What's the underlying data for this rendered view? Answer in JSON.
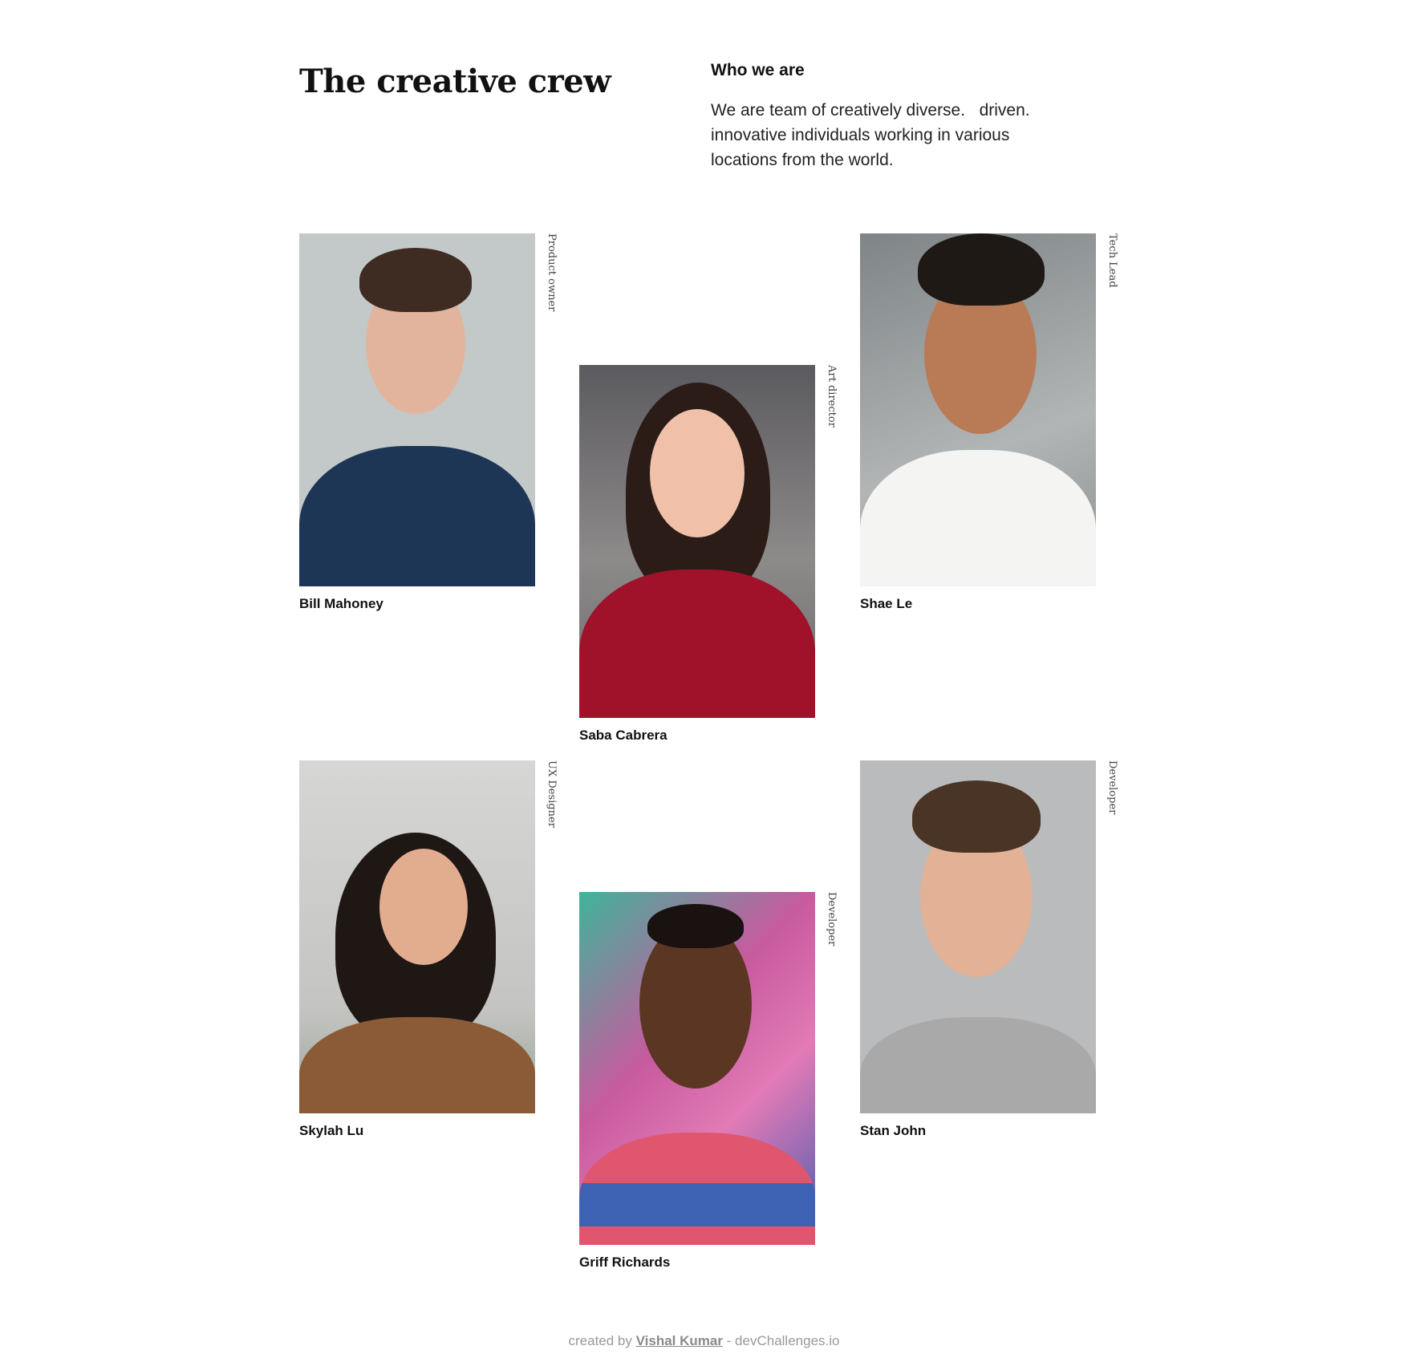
{
  "header": {
    "title": "The creative crew",
    "intro_heading": "Who we are",
    "intro_text": "We are team of creatively diverse.   driven.\ninnovative individuals working in various\nlocations from the world."
  },
  "team": [
    {
      "name": "Bill Mahoney",
      "role": "Product owner",
      "photo_icon": "portrait-photo"
    },
    {
      "name": "Saba Cabrera",
      "role": "Art director",
      "photo_icon": "portrait-photo"
    },
    {
      "name": "Shae Le",
      "role": "Tech Lead",
      "photo_icon": "portrait-photo"
    },
    {
      "name": "Skylah Lu",
      "role": "UX Designer",
      "photo_icon": "portrait-photo"
    },
    {
      "name": "Griff Richards",
      "role": "Developer",
      "photo_icon": "portrait-photo"
    },
    {
      "name": "Stan John",
      "role": "Developer",
      "photo_icon": "portrait-photo"
    }
  ],
  "footer": {
    "prefix": "created by ",
    "author": "Vishal Kumar",
    "suffix": " - devChallenges.io"
  }
}
